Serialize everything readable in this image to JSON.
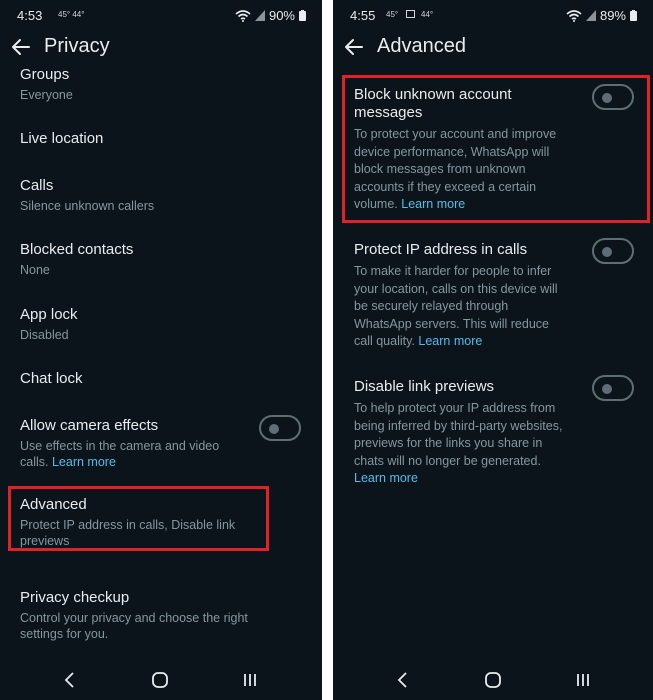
{
  "left": {
    "status": {
      "time": "4:53",
      "weather": "45° 44°",
      "battery": "90%"
    },
    "title": "Privacy",
    "items": [
      {
        "title": "Groups",
        "subtitle": "Everyone"
      },
      {
        "title": "Live location",
        "subtitle": ""
      },
      {
        "title": "Calls",
        "subtitle": "Silence unknown callers"
      },
      {
        "title": "Blocked contacts",
        "subtitle": "None"
      },
      {
        "title": "App lock",
        "subtitle": "Disabled"
      },
      {
        "title": "Chat lock",
        "subtitle": ""
      },
      {
        "title": "Allow camera effects",
        "subtitle": "Use effects in the camera and video calls.",
        "link": "Learn more"
      },
      {
        "title": "Advanced",
        "subtitle": "Protect IP address in calls, Disable link previews"
      },
      {
        "title": "Privacy checkup",
        "subtitle": "Control your privacy and choose the right settings for you."
      }
    ]
  },
  "right": {
    "status": {
      "time": "4:55",
      "weather": "45°",
      "weather2": "44°",
      "battery": "89%"
    },
    "title": "Advanced",
    "items": [
      {
        "title": "Block unknown account messages",
        "subtitle": "To protect your account and improve device performance, WhatsApp will block messages from unknown accounts if they exceed a certain volume.",
        "link": "Learn more"
      },
      {
        "title": "Protect IP address in calls",
        "subtitle": "To make it harder for people to infer your location, calls on this device will be securely relayed through WhatsApp servers. This will reduce call quality.",
        "link": "Learn more"
      },
      {
        "title": "Disable link previews",
        "subtitle": "To help protect your IP address from being inferred by third-party websites, previews for the links you share in chats will no longer be generated.",
        "link": "Learn more"
      }
    ]
  },
  "icons": [
    "back-arrow-icon",
    "wifi-icon",
    "signal-icon",
    "battery-icon",
    "nav-back-icon",
    "nav-home-icon",
    "nav-recents-icon"
  ],
  "colors": {
    "background": "#0b141a",
    "highlight": "#e02128",
    "link": "#53bdeb",
    "secondary_text": "#8696a0"
  }
}
